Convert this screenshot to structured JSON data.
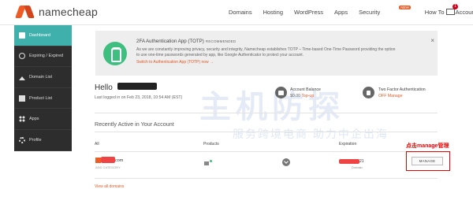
{
  "header": {
    "logo_text": "namecheap",
    "nav": [
      "Domains",
      "Hosting",
      "WordPress",
      "Apps",
      "Security",
      "How To",
      "Account"
    ],
    "security_badge": "NEW",
    "mail_count": "1"
  },
  "sidebar": {
    "items": [
      {
        "label": "Dashboard",
        "icon": "dashboard-icon"
      },
      {
        "label": "Expiring / Expired",
        "icon": "clock-icon"
      },
      {
        "label": "Domain List",
        "icon": "home-icon"
      },
      {
        "label": "Product List",
        "icon": "box-icon"
      },
      {
        "label": "Apps",
        "icon": "apps-icon"
      },
      {
        "label": "Profile",
        "icon": "gear-icon"
      }
    ]
  },
  "notice": {
    "title": "2FA Authentication App (TOTP)",
    "recommended": "RECOMMENDED",
    "text": "As we are constantly improving privacy, security and integrity, Namecheap establishes TOTP – Time-based One-Time Password providing the option to use one-time passwords generated by app, like Google Authenticator to protect your account.",
    "link": "Switch to Authentication App (TOTP) now →",
    "close": "×"
  },
  "welcome": {
    "hello": "Hello",
    "last_login": "Last logged in on Feb 23, 2018, 10:54 AM (EST)"
  },
  "account_balance": {
    "label": "Account Balance",
    "value": "$0.00",
    "link": "Top-up"
  },
  "two_factor": {
    "label": "Two Factor Authentication",
    "status": "OFF",
    "link": "Manage"
  },
  "recent": {
    "title": "Recently Active in Your Account",
    "columns": [
      "All",
      "Products",
      "Expiration"
    ],
    "row": {
      "domain_suffix": "com",
      "add_category": "ADD CATEGORY",
      "expiration_suffix": "21",
      "expiration_label": "Domain",
      "manage_label": "MANAGE"
    },
    "view_all": "View all domains"
  },
  "annotation": "点击manage管理",
  "watermark": {
    "main": "主机防探",
    "sub": "服务跨境电商 助力中企出海"
  },
  "colors": {
    "accent": "#3fb0ac",
    "brand": "#f05a24",
    "link": "#e05a26",
    "sidebar_bg": "#2d2d2d",
    "annotation": "#ee0000"
  }
}
